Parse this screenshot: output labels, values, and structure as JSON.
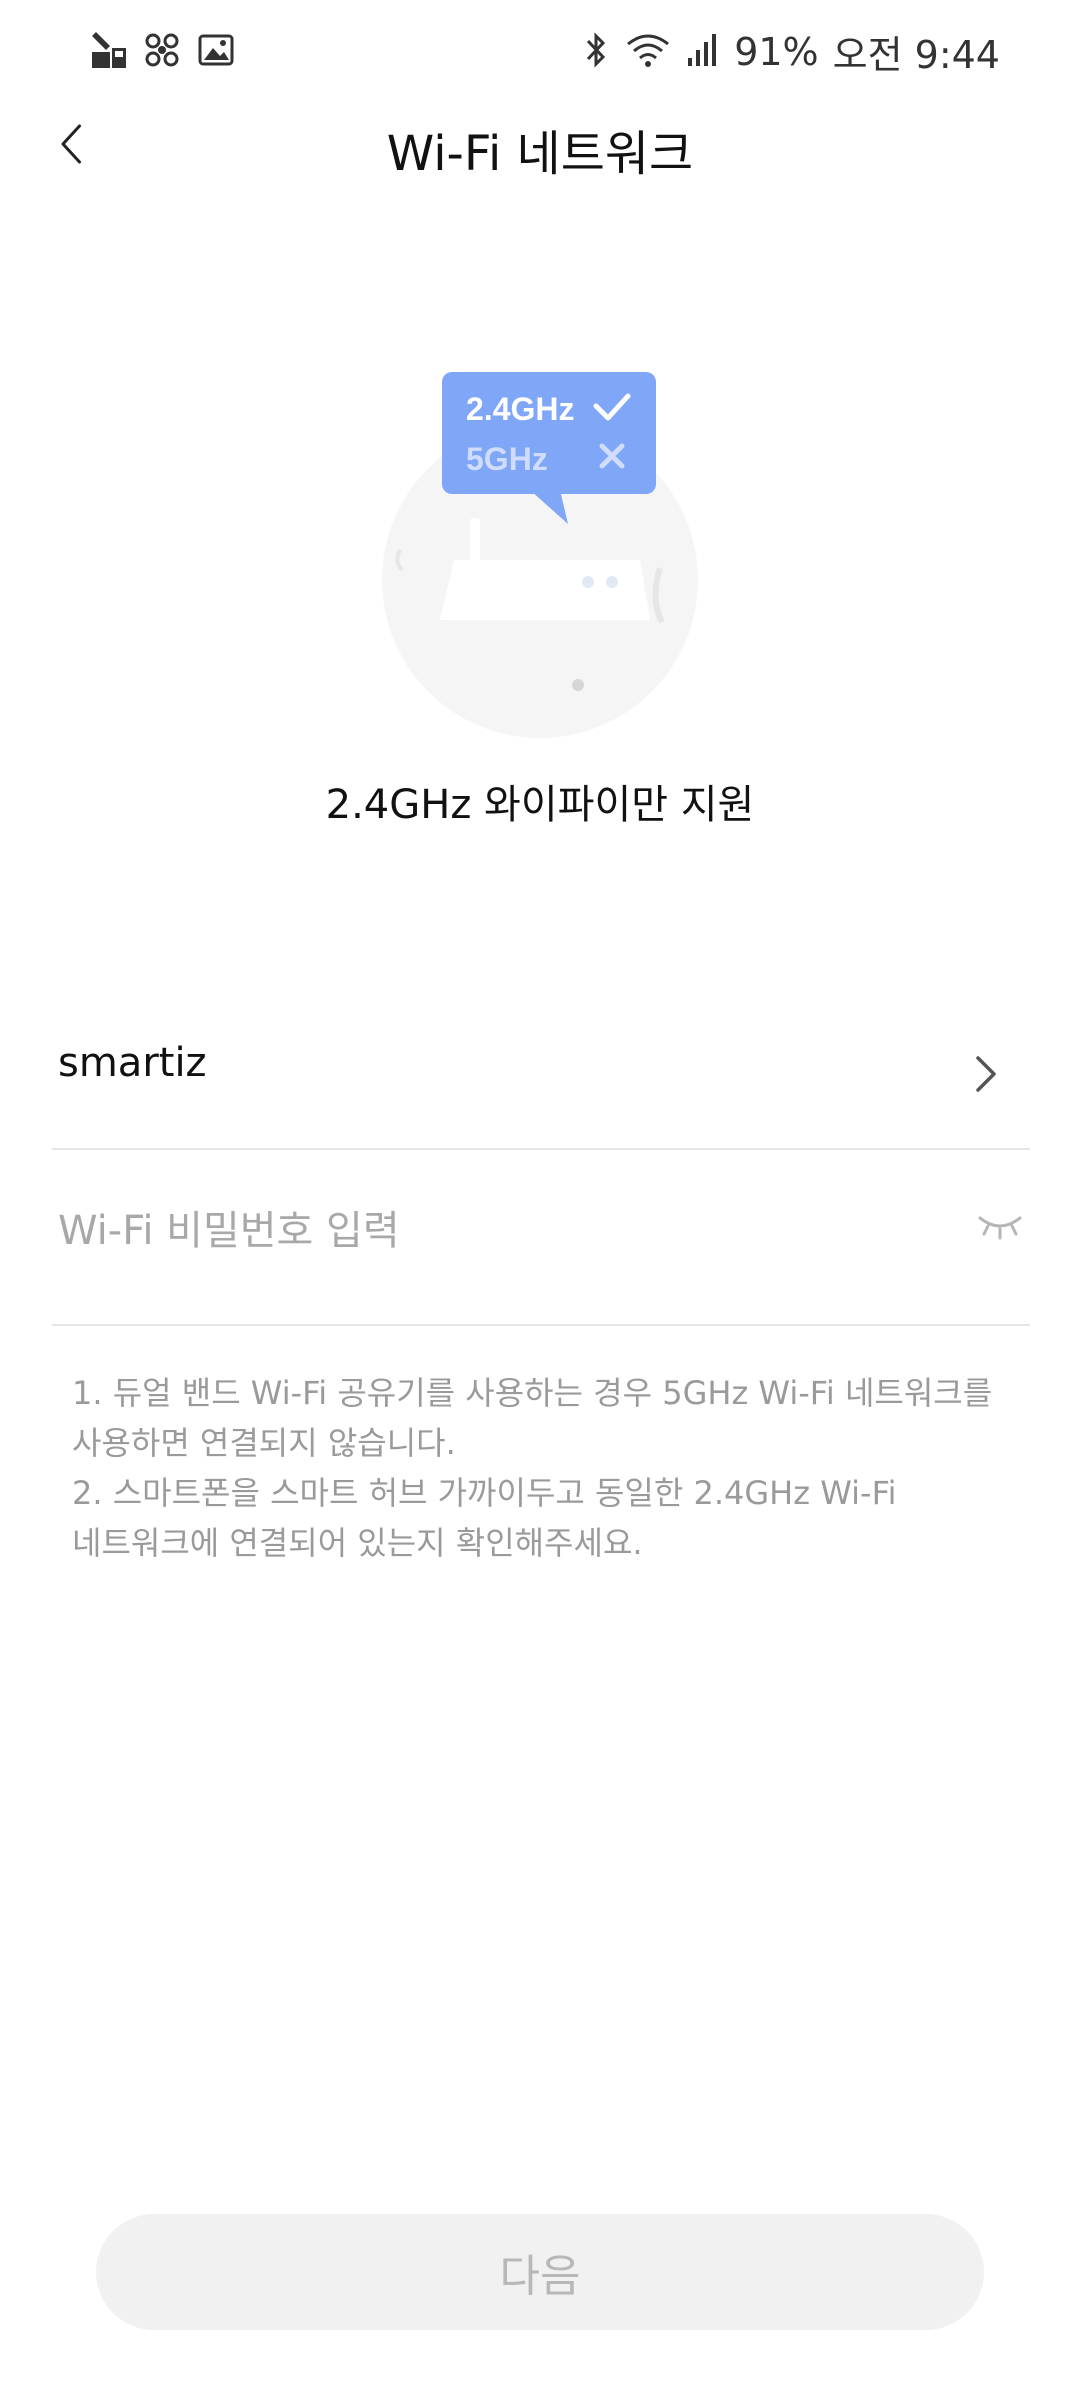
{
  "status_bar": {
    "battery": "91%",
    "time": "오전 9:44",
    "left_icons": [
      "recorder-icon",
      "fan-icon",
      "gallery-icon"
    ],
    "right_icons": [
      "bluetooth-icon",
      "wifi-icon",
      "signal-icon"
    ]
  },
  "header": {
    "title": "Wi-Fi 네트워크",
    "back_icon": "back-arrow-icon"
  },
  "illustration": {
    "band_supported": "2.4GHz",
    "band_unsupported": "5GHz",
    "colors": {
      "bubble": "#7fa6f7",
      "supported_text": "#ffffff",
      "unsupported_text": "#cfdcfb"
    }
  },
  "support_caption": "2.4GHz 와이파이만 지원",
  "network": {
    "ssid": "smartiz"
  },
  "password": {
    "placeholder": "Wi-Fi 비밀번호 입력",
    "value": ""
  },
  "notes": [
    "1. 듀얼 밴드 Wi-Fi 공유기를 사용하는 경우 5GHz Wi-Fi 네트워크를",
    "사용하면 연결되지 않습니다.",
    "2. 스마트폰을 스마트 허브 가까이두고 동일한 2.4GHz Wi-Fi",
    "네트워크에 연결되어 있는지 확인해주세요."
  ],
  "next_button": {
    "label": "다음",
    "state": "disabled"
  }
}
